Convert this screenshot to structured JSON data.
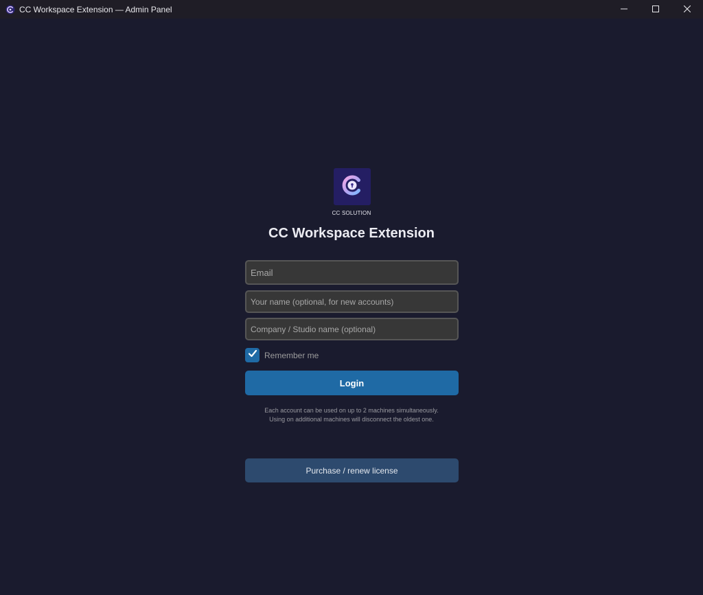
{
  "window": {
    "title": "CC Workspace Extension — Admin Panel",
    "icons": {
      "app": "cc-logo-icon",
      "minimize": "minimize-icon",
      "maximize": "maximize-icon",
      "close": "close-icon"
    }
  },
  "brand": {
    "logo_icon": "cc-lock-logo-icon",
    "caption": "CC SOLUTION",
    "heading": "CC Workspace Extension",
    "logo_bg": "#241e63"
  },
  "form": {
    "email_placeholder": "Email",
    "email_value": "",
    "name_placeholder": "Your name (optional, for new accounts)",
    "name_value": "",
    "company_placeholder": "Company / Studio name (optional)",
    "company_value": "",
    "remember_label": "Remember me",
    "remember_checked": true,
    "login_label": "Login",
    "notice_line1": "Each account can be used on up to 2 machines simultaneously.",
    "notice_line2": "Using on additional machines will disconnect the oldest one.",
    "purchase_label": "Purchase / renew license"
  },
  "colors": {
    "background": "#1a1b2e",
    "titlebar": "#1f1d26",
    "accent": "#1f6aa5",
    "secondary_button": "#2d4a6e",
    "field_bg": "#373737",
    "field_border": "#565656"
  }
}
